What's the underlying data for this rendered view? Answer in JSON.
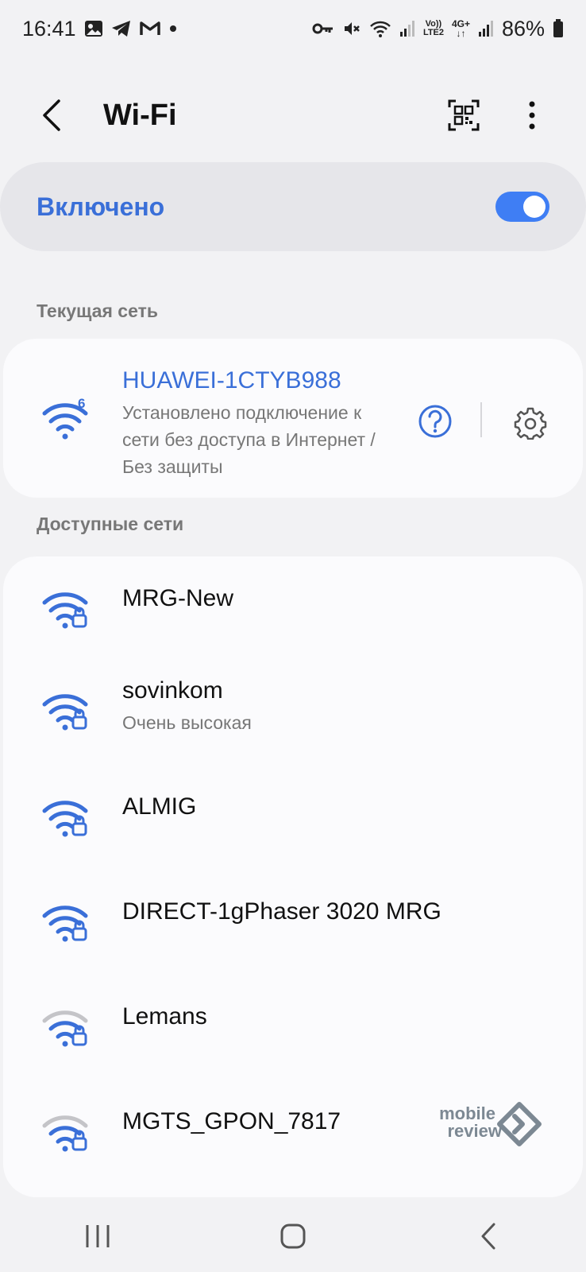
{
  "status_bar": {
    "time": "16:41",
    "battery": "86%",
    "left_icons": [
      "gallery-icon",
      "telegram-icon",
      "gmail-icon",
      "dot-icon"
    ],
    "right_icons": [
      "key-icon",
      "mute-icon",
      "wifi-icon",
      "signal-icon",
      "volte-icon",
      "4g-icon",
      "signal-icon",
      "battery-icon"
    ],
    "volte_text": "Vo)) LTE2",
    "network_text": "4G+"
  },
  "app_bar": {
    "title": "Wi-Fi"
  },
  "toggle": {
    "label": "Включено",
    "on": true
  },
  "current_section": {
    "label": "Текущая сеть",
    "network": {
      "name": "HUAWEI-1CTYB988",
      "status": "Установлено подключение к сети без доступа в Интернет / Без защиты",
      "badge": "6"
    }
  },
  "available_section": {
    "label": "Доступные сети",
    "networks": [
      {
        "name": "MRG-New",
        "sub": "",
        "signal": "strong"
      },
      {
        "name": "sovinkom",
        "sub": "Очень высокая",
        "signal": "strong"
      },
      {
        "name": "ALMIG",
        "sub": "",
        "signal": "strong"
      },
      {
        "name": "DIRECT-1gPhaser 3020 MRG",
        "sub": "",
        "signal": "strong"
      },
      {
        "name": "Lemans",
        "sub": "",
        "signal": "weak"
      },
      {
        "name": "MGTS_GPON_7817",
        "sub": "",
        "signal": "weak"
      }
    ]
  },
  "watermark": {
    "line1": "mobile",
    "line2": "review"
  },
  "colors": {
    "accent": "#3a6fd8",
    "switch": "#3f7ef4",
    "weak_signal": "#c4c4c8"
  }
}
